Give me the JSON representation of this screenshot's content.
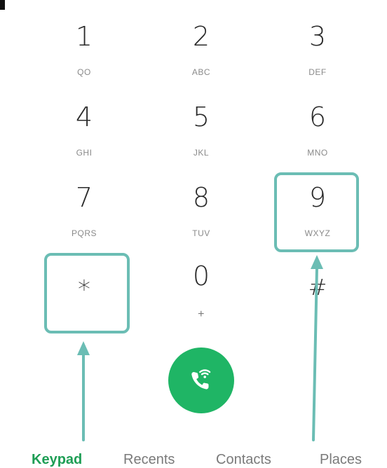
{
  "keypad": {
    "keys": [
      {
        "digit": "1",
        "letters": "QO"
      },
      {
        "digit": "2",
        "letters": "ABC"
      },
      {
        "digit": "3",
        "letters": "DEF"
      },
      {
        "digit": "4",
        "letters": "GHI"
      },
      {
        "digit": "5",
        "letters": "JKL"
      },
      {
        "digit": "6",
        "letters": "MNO"
      },
      {
        "digit": "7",
        "letters": "PQRS"
      },
      {
        "digit": "8",
        "letters": "TUV"
      },
      {
        "digit": "9",
        "letters": "WXYZ"
      },
      {
        "digit": "*",
        "letters": ""
      },
      {
        "digit": "0",
        "letters": "+"
      },
      {
        "digit": "#",
        "letters": ""
      }
    ]
  },
  "call_button": {
    "icon": "phone-wifi-call-icon",
    "color": "#1fb565"
  },
  "annotations": {
    "highlight_color": "#6bbdb4",
    "highlighted_keys": [
      "9",
      "*"
    ]
  },
  "tabs": [
    {
      "label": "Keypad",
      "active": true
    },
    {
      "label": "Recents",
      "active": false
    },
    {
      "label": "Contacts",
      "active": false
    },
    {
      "label": "Places",
      "active": false
    }
  ],
  "colors": {
    "active_tab": "#1e9e55",
    "inactive_tab": "#7a7a7a"
  }
}
